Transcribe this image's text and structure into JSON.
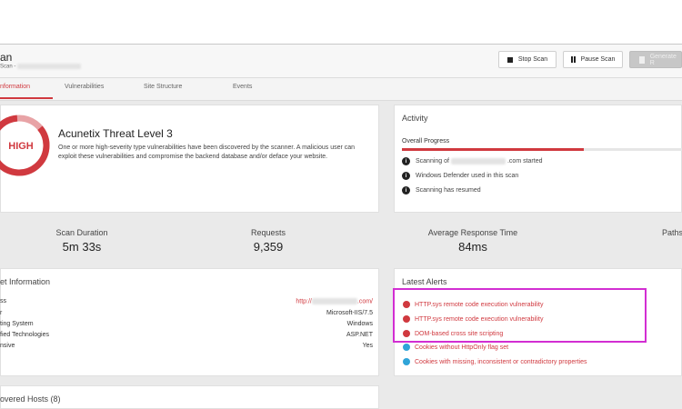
{
  "header": {
    "title": "an",
    "subtitle": "Scan - "
  },
  "buttons": {
    "stop_scan": "Stop Scan",
    "pause_scan": "Pause Scan",
    "generate_report": "Generate R"
  },
  "tabs": [
    {
      "label": "nformation",
      "active": true
    },
    {
      "label": "Vulnerabilities",
      "active": false
    },
    {
      "label": "Site Structure",
      "active": false
    },
    {
      "label": "Events",
      "active": false
    }
  ],
  "threat": {
    "badge": "HIGH",
    "title": "Acunetix Threat Level 3",
    "description": "One or more high-severity type vulnerabilities have been discovered by the scanner. A malicious user can exploit these vulnerabilities and compromise the backend database and/or deface your website."
  },
  "activity": {
    "title": "Activity",
    "progress_label": "Overall Progress",
    "progress_fraction": 0.65,
    "items": [
      {
        "prefix": "Scanning of ",
        "suffix": ".com started"
      },
      {
        "prefix": "Windows Defender used in this scan",
        "suffix": ""
      },
      {
        "prefix": "Scanning has resumed",
        "suffix": ""
      }
    ]
  },
  "stats": [
    {
      "label": "Scan Duration",
      "value": "5m 33s"
    },
    {
      "label": "Requests",
      "value": "9,359"
    },
    {
      "label": "Average Response Time",
      "value": "84ms"
    },
    {
      "label": "Paths",
      "value": ""
    }
  ],
  "target_info": {
    "title": "et Information",
    "rows": [
      {
        "label": "ss",
        "value_prefix": "http://",
        "value_suffix": ".com/"
      },
      {
        "label": "r",
        "value_prefix": "Microsoft-IIS/7.5",
        "value_suffix": ""
      },
      {
        "label": "ting System",
        "value_prefix": "Windows",
        "value_suffix": ""
      },
      {
        "label": "fied Technologies",
        "value_prefix": "ASP.NET",
        "value_suffix": ""
      },
      {
        "label": "nsive",
        "value_prefix": "Yes",
        "value_suffix": ""
      }
    ]
  },
  "alerts": {
    "title": "Latest Alerts",
    "items": [
      {
        "label": "HTTP.sys remote code execution vulnerability",
        "severity": "high"
      },
      {
        "label": "HTTP.sys remote code execution vulnerability",
        "severity": "high"
      },
      {
        "label": "DOM-based cross site scripting",
        "severity": "high"
      },
      {
        "label": "Cookies without HttpOnly flag set",
        "severity": "info"
      },
      {
        "label": "Cookies with missing, inconsistent or contradictory properties",
        "severity": "info"
      }
    ]
  },
  "hosts": {
    "title": "overed Hosts (8)"
  },
  "colors": {
    "accent": "#d0393f",
    "info": "#2fa4d8",
    "highlight": "#d22ed2"
  }
}
